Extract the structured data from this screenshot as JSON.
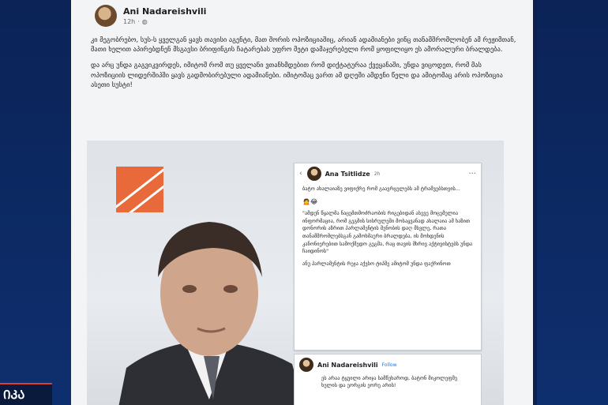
{
  "channel": {
    "label": "ᲘᲙᲐ"
  },
  "post": {
    "author": "Ani Nadareishvili",
    "time": "12h",
    "paragraph1": "კი მეგობრებო, სუს-ს ყველგან ყავს თავისი აგენტი, მათ შორის ოპოზიციაშიც, არიან ადამიანები ვინც თანამშრომლობენ ამ რეჟიმთან, მათი ხელით აპირებდნენ მსგავსი ბრიფინგის ჩატარებას უფრო მეტი დამაჯერებელი რომ ყოფილიყო ეს ამორალური ბრალდება.",
    "paragraph2": "და არც უნდა გაგვიკვირდეს, იმიტომ რომ თუ ყველანი ვთანხმდებით რომ დიქტატურაა ქვეყანაში, უნდა ვიცოდეთ, რომ მას ოპოზიციის ლიდერშიპში ყავს გადმობირებული ადამიანები. იმიტომაც ვართ ამ დღეში ამდენი წელი და ამიტომაც არის ოპოზიცია ასეთი სუსტი!"
  },
  "screenshot1": {
    "author": "Ana Tsitlidze",
    "time": "2h",
    "line1": "ბატო ახალაიაზე ვიფიქრე რომ გაავრცელებს ამ ტრამვებსთვის...",
    "quote": "\"ამდენ წყალმა ნაცემთმოძრაობის რიგებიდან ასევე მოცემულია ინფორმაცია, რომ გეგმის სისრულეში მოსაყვანად ახალაია ამ ხაზით დონორის აზრით პარლამენტის შენობის დაღ მსვლე, რათა თანამშრომლებსგან გამოხმაური ბრალდება, ის მოხდენის კანონიერებით სამოქმედო გეგმა, რაც თავის მხრივ აქტივისტებს უნდა ჩაიდინოს\"",
    "line2": "ანუ პარლამენტის რეჯა აქვსო ტიპშე ამიტომ უნდა ფაქრინოთ"
  },
  "screenshot2": {
    "author": "Ani Nadareishvili",
    "follow": "Follow",
    "text": "ეს არაა ტყუილი არიჯა სამწუხაროდ, ბატონ მიკოლეფმე ხელის და ეორგის ეორე არის!"
  }
}
